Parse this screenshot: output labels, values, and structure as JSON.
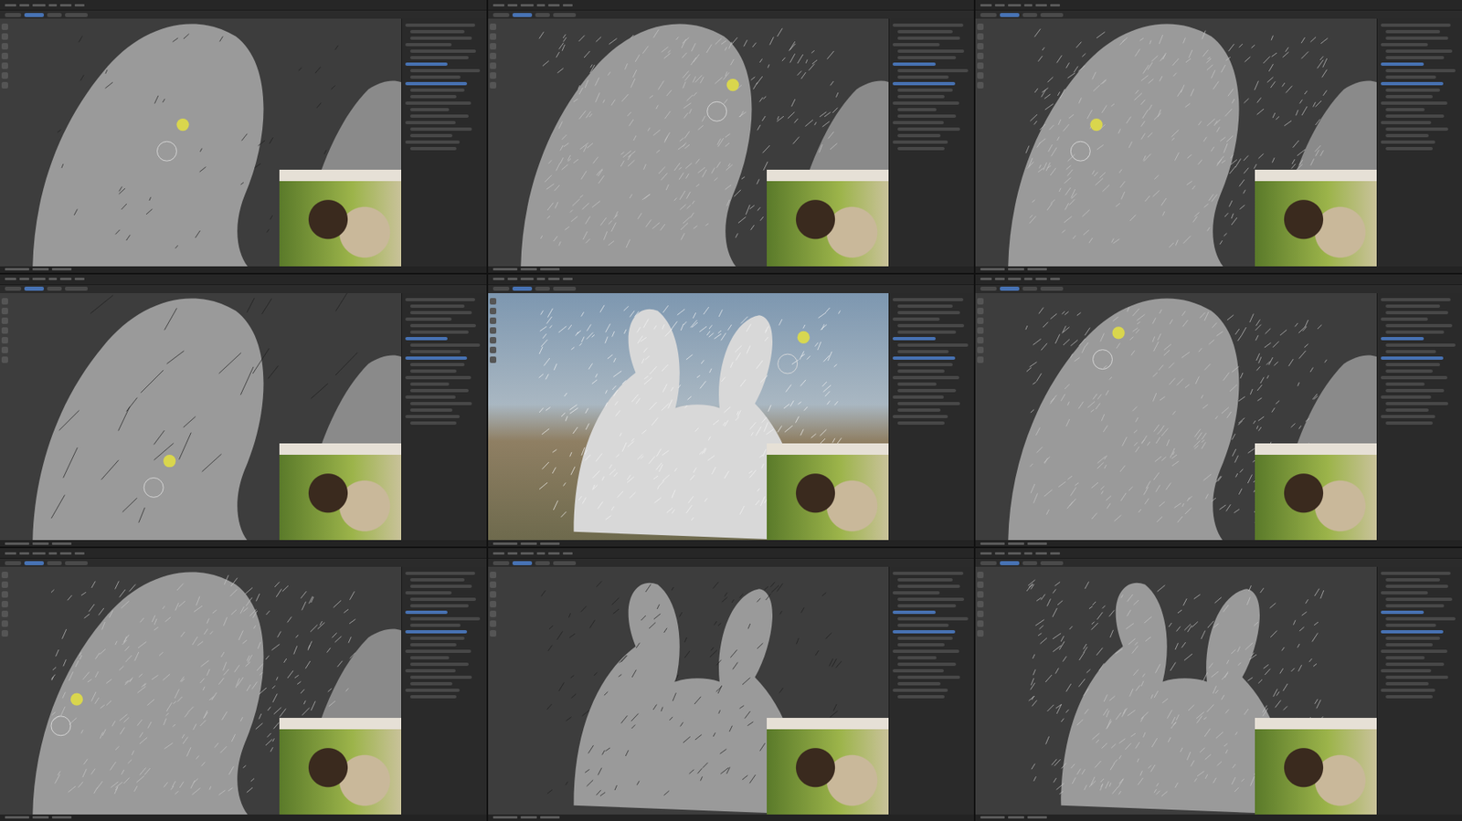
{
  "grid": {
    "columns": 3,
    "rows": 3
  },
  "panels": [
    {
      "kind": "sparse",
      "view": "ear-base"
    },
    {
      "kind": "furred",
      "view": "ear-side"
    },
    {
      "kind": "furred",
      "view": "ear-front"
    },
    {
      "kind": "strands",
      "view": "ear-base"
    },
    {
      "kind": "render",
      "view": "head-front"
    },
    {
      "kind": "furred",
      "view": "ear-front"
    },
    {
      "kind": "furred",
      "view": "ear-edge"
    },
    {
      "kind": "head",
      "view": "head-front"
    },
    {
      "kind": "furred",
      "view": "head-front"
    }
  ]
}
